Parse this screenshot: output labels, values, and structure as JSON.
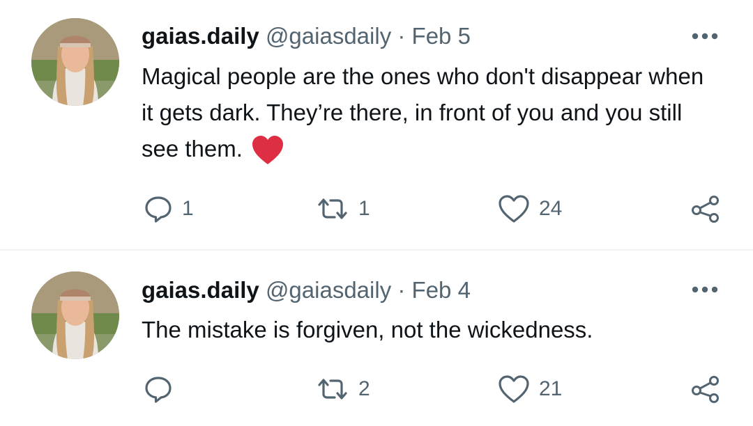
{
  "tweets": [
    {
      "display_name": "gaias.daily",
      "handle": "@gaiasdaily",
      "separator": "·",
      "date": "Feb 5",
      "text": "Magical people are the ones who don't disappear when it gets dark. They’re there, in front of you and you still see them.",
      "emoji": "red-heart-emoji",
      "replies": "1",
      "retweets": "1",
      "likes": "24"
    },
    {
      "display_name": "gaias.daily",
      "handle": "@gaiasdaily",
      "separator": "·",
      "date": "Feb 4",
      "text": "The mistake is forgiven, not the wickedness.",
      "replies": "",
      "retweets": "2",
      "likes": "21"
    }
  ],
  "icons": {
    "reply": "reply-icon",
    "retweet": "retweet-icon",
    "like": "heart-icon",
    "share": "share-icon",
    "more": "more-icon"
  },
  "colors": {
    "text": "#0f1419",
    "secondary": "#536471",
    "divider": "#eff3f4",
    "emoji_heart": "#dd2e44"
  }
}
